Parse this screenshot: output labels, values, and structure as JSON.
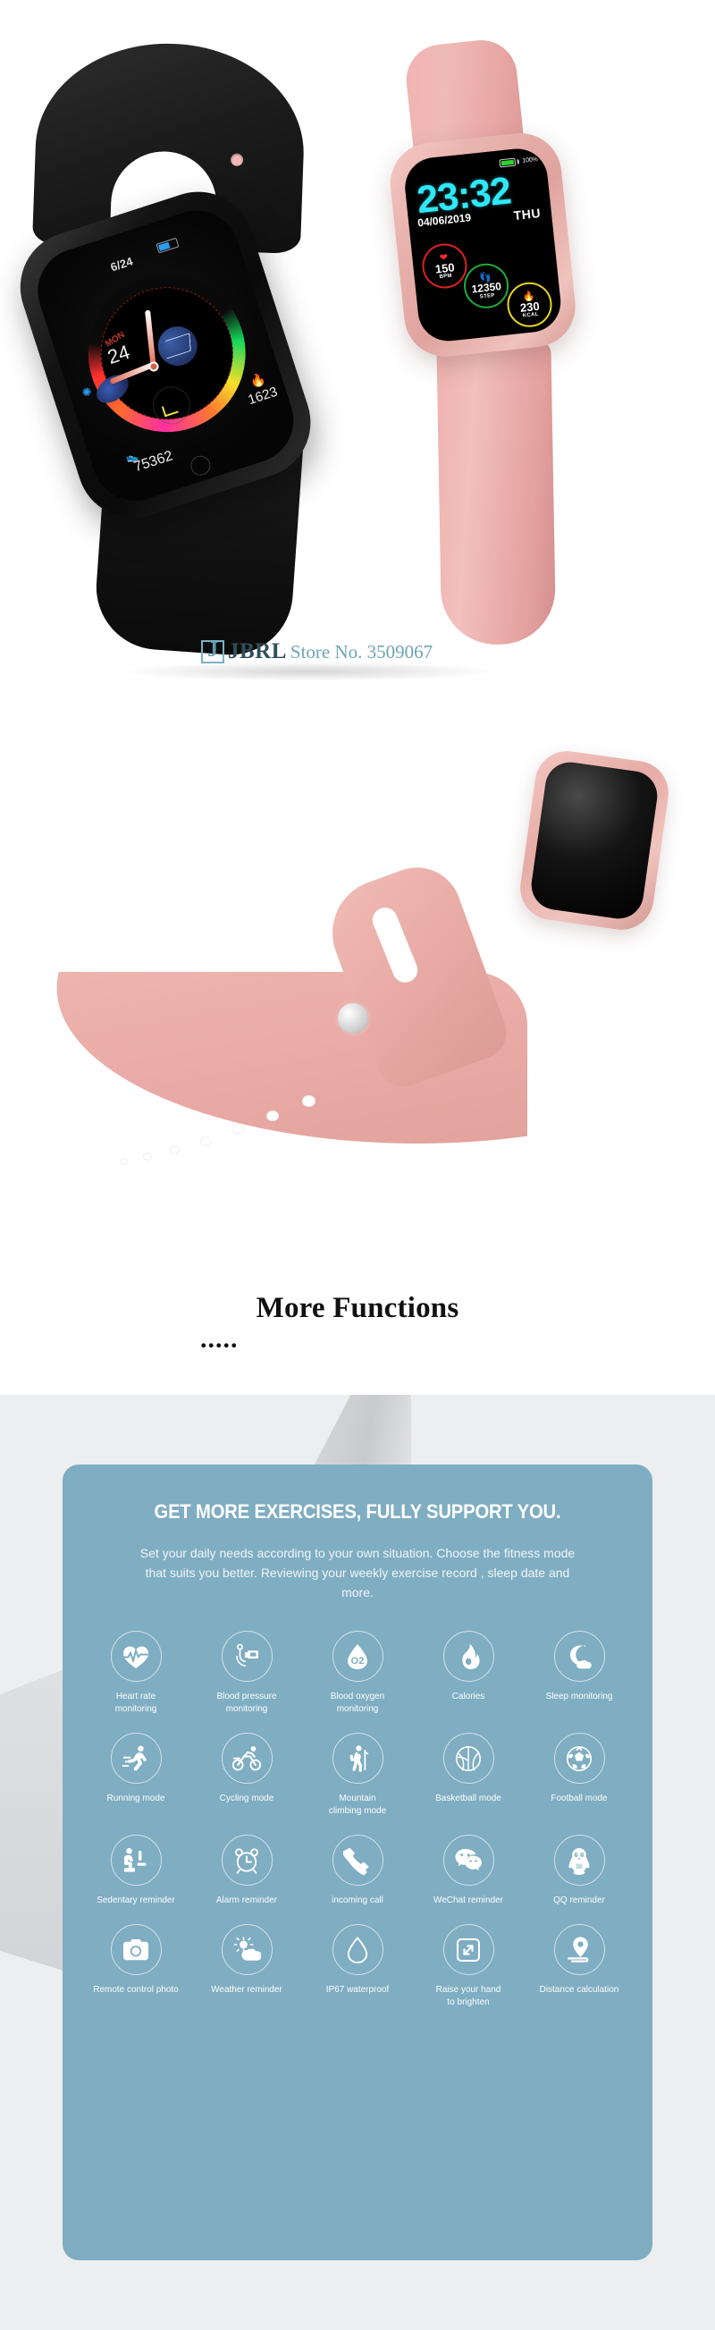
{
  "hero": {
    "pink_watch": {
      "time": "23:32",
      "date": "04/06/2019",
      "day_of_week": "THU",
      "battery_percent": "100%",
      "metrics": [
        {
          "icon": "heart-icon",
          "value": "150",
          "unit": "BPM",
          "color": "#e02020"
        },
        {
          "icon": "footsteps-icon",
          "value": "12350",
          "unit": "STEP",
          "color": "#1faa3c"
        },
        {
          "icon": "flame-icon",
          "value": "230",
          "unit": "KCAL",
          "color": "#e8d423"
        }
      ]
    },
    "black_watch": {
      "date": "6/24",
      "day_label": "MON",
      "day_number": "24",
      "calories": "1623",
      "steps": "75362"
    },
    "watermark": {
      "logo_letter": "J",
      "brand": "JBRL",
      "store": "Store No. 3509067"
    }
  },
  "strap_section": {
    "heading": "More Functions",
    "dots": "....."
  },
  "features": {
    "title": "GET MORE EXERCISES, FULLY SUPPORT YOU.",
    "subtitle": "Set your daily needs according to your own situation. Choose the fitness mode that suits you better. Reviewing your weekly exercise record , sleep date and more.",
    "card_color": "#7fadc2",
    "items": [
      {
        "icon": "heart-rate-icon",
        "label": "Heart rate\nmonitoring"
      },
      {
        "icon": "blood-pressure-icon",
        "label": "Blood pressure\nmonitoring"
      },
      {
        "icon": "blood-oxygen-icon",
        "label": "Blood oxygen\nmonitoring"
      },
      {
        "icon": "flame-icon",
        "label": "Calories"
      },
      {
        "icon": "moon-cloud-icon",
        "label": "Sleep monitoring"
      },
      {
        "icon": "running-icon",
        "label": "Running mode"
      },
      {
        "icon": "cycling-icon",
        "label": "Cycling mode"
      },
      {
        "icon": "hiking-icon",
        "label": "Mountain\nclimbing mode"
      },
      {
        "icon": "basketball-icon",
        "label": "Basketball mode"
      },
      {
        "icon": "football-icon",
        "label": "Football mode"
      },
      {
        "icon": "sedentary-icon",
        "label": "Sedentary reminder"
      },
      {
        "icon": "alarm-clock-icon",
        "label": "Alarm reminder"
      },
      {
        "icon": "phone-call-icon",
        "label": "incoming call"
      },
      {
        "icon": "wechat-icon",
        "label": "WeChat reminder"
      },
      {
        "icon": "qq-penguin-icon",
        "label": "QQ reminder"
      },
      {
        "icon": "camera-icon",
        "label": "Remote control photo"
      },
      {
        "icon": "weather-icon",
        "label": "Weather reminder"
      },
      {
        "icon": "water-drop-icon",
        "label": "IP67 waterproof"
      },
      {
        "icon": "raise-hand-icon",
        "label": "Raise your hand\nto brighten"
      },
      {
        "icon": "location-pin-icon",
        "label": "Distance calculation"
      }
    ]
  }
}
